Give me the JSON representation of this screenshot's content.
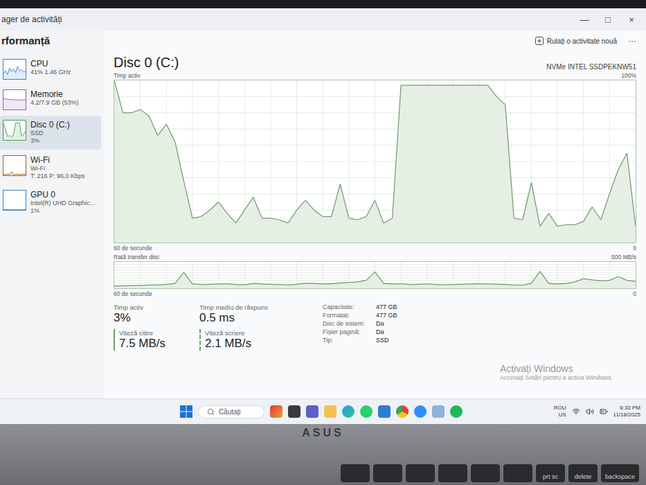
{
  "window": {
    "title": "ager de activități",
    "controls": [
      "—",
      "□",
      "×"
    ]
  },
  "page_title": "rformanță",
  "sidebar": {
    "items": [
      {
        "name": "CPU",
        "lines": [
          "41% 1.46 GHz"
        ],
        "selected": false,
        "color": "#3b86c6",
        "spark": [
          30,
          45,
          25,
          60,
          40,
          55,
          35,
          70,
          45,
          50,
          38,
          42
        ]
      },
      {
        "name": "Memorie",
        "lines": [
          "4.2/7.9 GB (53%)"
        ],
        "selected": false,
        "color": "#8e5fb3",
        "spark": [
          60,
          58,
          57,
          55,
          55,
          54,
          53,
          53,
          53,
          53,
          53,
          53
        ]
      },
      {
        "name": "Disc 0 (C:)",
        "lines": [
          "SSD",
          "3%"
        ],
        "selected": true,
        "color": "#4f9a4f",
        "spark": [
          90,
          60,
          20,
          25,
          15,
          30,
          95,
          95,
          95,
          20,
          30,
          50
        ]
      },
      {
        "name": "Wi-Fi",
        "lines": [
          "Wi-Fi",
          "T: 216 P: 96.0 Kbps"
        ],
        "selected": false,
        "color": "#a8621b",
        "spark": [
          5,
          4,
          6,
          5,
          20,
          4,
          5,
          6,
          4,
          5,
          7,
          5
        ]
      },
      {
        "name": "GPU 0",
        "lines": [
          "Intel(R) UHD Graphic…",
          "1%"
        ],
        "selected": false,
        "color": "#3b86c6",
        "spark": [
          2,
          1,
          2,
          1,
          1,
          2,
          1,
          1,
          2,
          1,
          1,
          1
        ]
      }
    ]
  },
  "toolbar": {
    "run_task": "Rulați o activitate nouă",
    "more": "···"
  },
  "disk": {
    "title": "Disc 0 (C:)",
    "model": "NVMe INTEL SSDPEKNW51"
  },
  "active_chart": {
    "label": "Timp activ",
    "max_label": "100%",
    "min_label": "0",
    "time_label": "60 de secunde",
    "max": 100,
    "values": [
      100,
      80,
      80,
      82,
      78,
      66,
      73,
      62,
      38,
      15,
      16,
      20,
      25,
      18,
      12,
      20,
      28,
      15,
      15,
      14,
      12,
      20,
      26,
      20,
      16,
      16,
      36,
      15,
      14,
      16,
      26,
      12,
      15,
      97,
      97,
      97,
      97,
      97,
      97,
      97,
      97,
      97,
      97,
      97,
      90,
      85,
      15,
      14,
      37,
      10,
      18,
      10,
      11,
      11,
      13,
      22,
      14,
      30,
      45,
      55,
      10
    ]
  },
  "transfer_chart": {
    "label": "Rată transfer disc",
    "max_label": "500 MB/s",
    "min_label": "0",
    "time_label": "60 de secunde",
    "max": 500,
    "values": [
      40,
      45,
      50,
      55,
      60,
      65,
      70,
      90,
      300,
      80,
      70,
      75,
      80,
      85,
      70,
      65,
      90,
      80,
      75,
      70,
      60,
      75,
      95,
      90,
      80,
      85,
      100,
      110,
      120,
      150,
      310,
      90,
      80,
      85,
      70,
      75,
      80,
      70,
      65,
      70,
      75,
      80,
      85,
      80,
      75,
      70,
      60,
      60,
      90,
      320,
      90,
      80,
      90,
      120,
      180,
      160,
      140,
      150,
      220,
      150,
      130
    ]
  },
  "stats": [
    {
      "label": "Timp activ",
      "value": "3%"
    },
    {
      "label": "Timp mediu de răspuns",
      "value": "0.5 ms"
    }
  ],
  "speeds": [
    {
      "label": "Viteză citire",
      "value": "7.5 MB/s",
      "kind": "read"
    },
    {
      "label": "Viteză scriere",
      "value": "2.1 MB/s",
      "kind": "write"
    }
  ],
  "properties": [
    {
      "label": "Capacitate:",
      "value": "477 GB"
    },
    {
      "label": "Formatat:",
      "value": "477 GB"
    },
    {
      "label": "Disc de sistem:",
      "value": "Da"
    },
    {
      "label": "Fișier pagină:",
      "value": "Da"
    },
    {
      "label": "Tip:",
      "value": "SSD"
    }
  ],
  "watermark": {
    "title": "Activați Windows",
    "subtitle": "Accesați Setări pentru a activa Windows."
  },
  "taskbar": {
    "search_placeholder": "Căutați",
    "apps": [
      {
        "kind": "game"
      },
      {
        "kind": "files"
      },
      {
        "kind": "teams"
      },
      {
        "kind": "folder"
      },
      {
        "kind": "edge"
      },
      {
        "kind": "whatsapp"
      },
      {
        "kind": "store"
      },
      {
        "kind": "chrome"
      },
      {
        "kind": "zoom"
      },
      {
        "kind": "chart"
      },
      {
        "kind": "spotify"
      }
    ],
    "tray": {
      "lang": "ROU",
      "layout": "US",
      "time": "6:33 PM",
      "date": "11/18/2025"
    }
  },
  "laptop": {
    "logo": "ASUS",
    "keys": [
      "prt sc",
      "delete",
      "backspace"
    ]
  }
}
